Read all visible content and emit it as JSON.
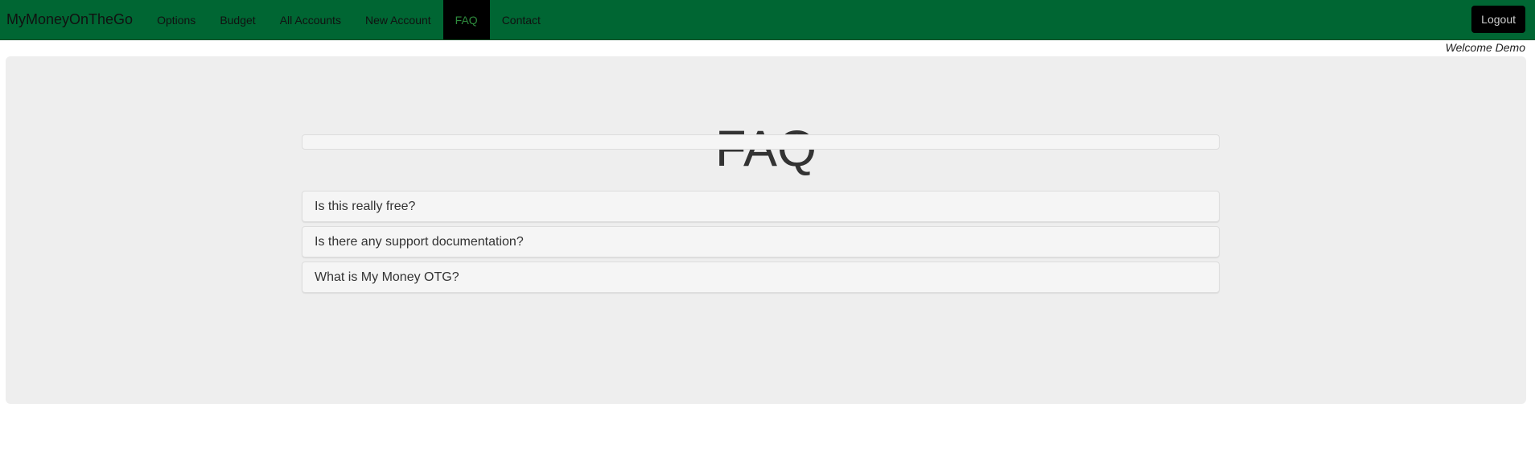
{
  "navbar": {
    "brand": "MyMoneyOnTheGo",
    "items": [
      {
        "label": "Options"
      },
      {
        "label": "Budget"
      },
      {
        "label": "All Accounts"
      },
      {
        "label": "New Account"
      },
      {
        "label": "FAQ"
      },
      {
        "label": "Contact"
      }
    ],
    "active_item": "FAQ",
    "logout_label": "Logout"
  },
  "welcome_text": "Welcome Demo",
  "page": {
    "title": "FAQ",
    "questions": [
      {
        "question": "Is this really free?"
      },
      {
        "question": "Is there any support documentation?"
      },
      {
        "question": "What is My Money OTG?"
      }
    ]
  },
  "colors": {
    "navbar_bg": "#006633",
    "active_tab_bg": "#000000",
    "active_tab_text": "#2e8b3d",
    "jumbotron_bg": "#eeeeee",
    "panel_bg": "#f5f5f5"
  }
}
